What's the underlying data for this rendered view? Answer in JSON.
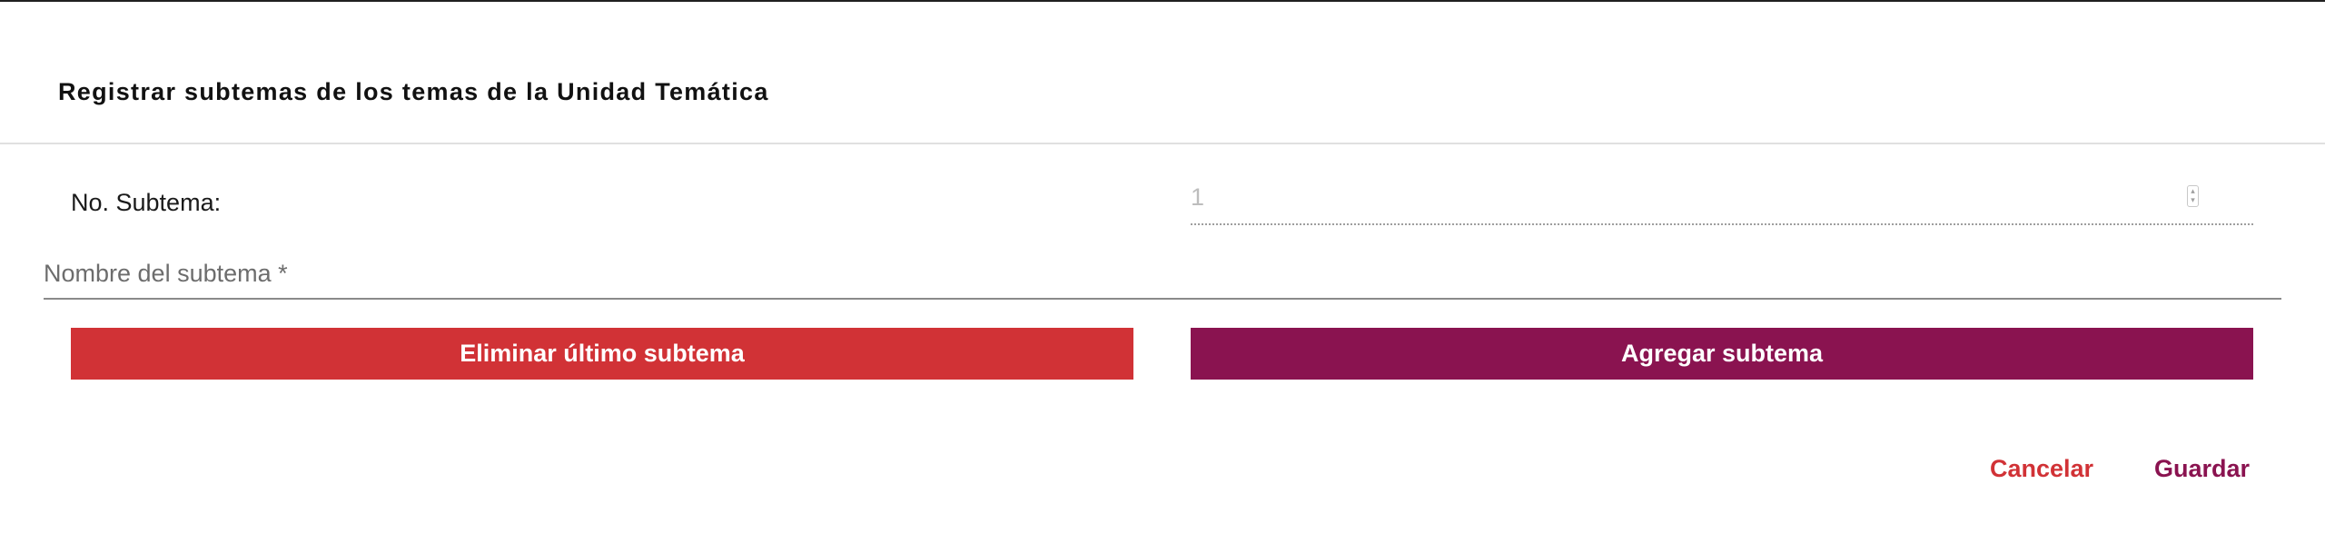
{
  "dialog": {
    "title": "Registrar subtemas de los temas de la Unidad Temática"
  },
  "form": {
    "subtopic_number_label": "No. Subtema:",
    "subtopic_number_value": "1",
    "subtopic_name_placeholder": "Nombre del subtema *"
  },
  "buttons": {
    "delete_last_label": "Eliminar último subtema",
    "add_label": "Agregar subtema"
  },
  "actions": {
    "cancel_label": "Cancelar",
    "save_label": "Guardar"
  },
  "colors": {
    "danger": "#d13236",
    "primary": "#8a1350",
    "placeholder": "#6d6d6d",
    "disabled_text": "#bdbdbd"
  },
  "icons": {
    "number_spinner": "spinner-icon"
  }
}
